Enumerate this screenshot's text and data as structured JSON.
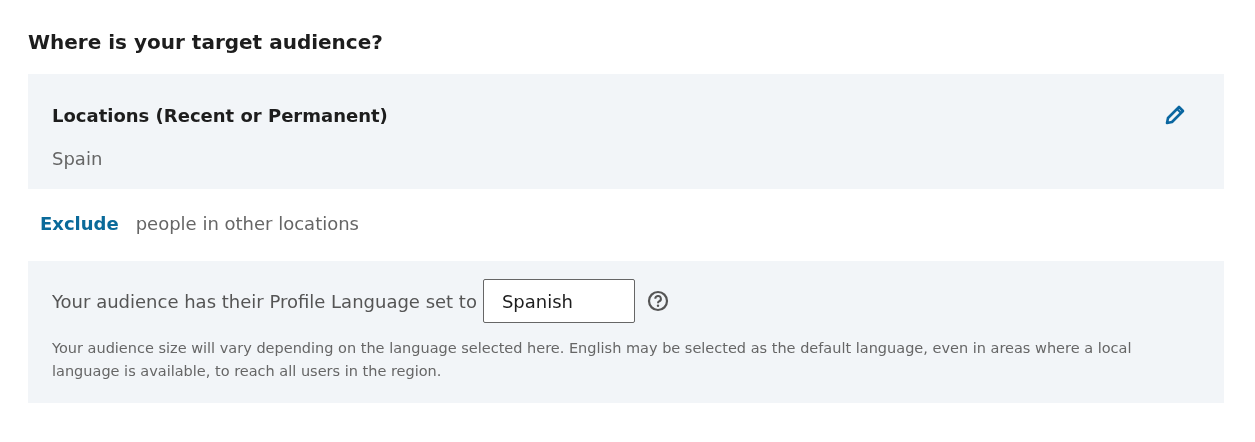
{
  "heading": "Where is your target audience?",
  "locations": {
    "title": "Locations (Recent or Permanent)",
    "value": "Spain"
  },
  "exclude": {
    "link": "Exclude",
    "text": "people in other locations"
  },
  "language": {
    "label": "Your audience has their Profile Language set to",
    "value": "Spanish",
    "note": "Your audience size will vary depending on the language selected here. English may be selected as the default language, even in areas where a local language is available, to reach all users in the region."
  }
}
